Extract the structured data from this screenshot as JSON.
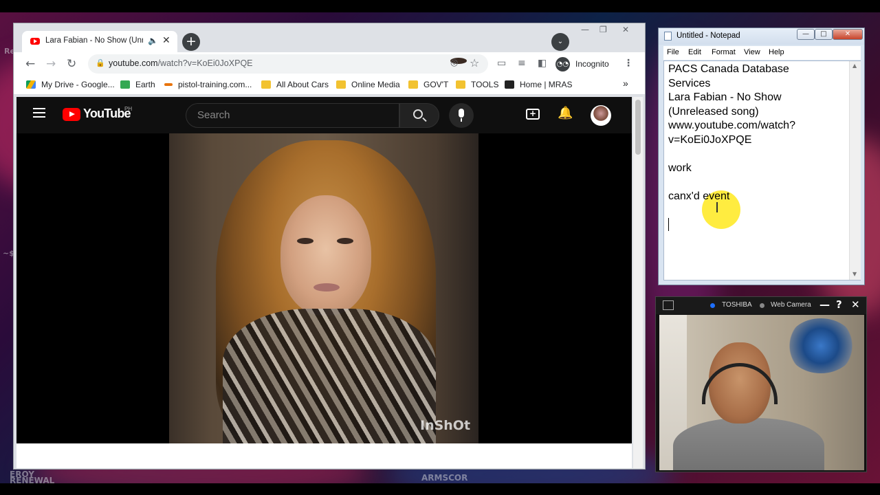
{
  "desktop": {
    "left_edge_text_1": "Re",
    "left_edge_text_2": "~$",
    "bottom_text_1": "EROY",
    "bottom_text_2": "RENEWAL",
    "bottom_text_3": "ARMSCOR"
  },
  "chrome": {
    "tab": {
      "title": "Lara Fabian - No Show (Unre",
      "close": "✕",
      "speaker": "🔈"
    },
    "new_tab": "+",
    "tab_search": "⌄",
    "window_controls": {
      "minimize": "—",
      "maximize": "❐",
      "close": "✕"
    },
    "nav": {
      "back": "←",
      "forward": "→",
      "reload": "↻"
    },
    "address": {
      "host": "youtube.com",
      "path": "/watch?v=KoEi0JoXPQE"
    },
    "incognito_label": "Incognito",
    "bookmarks": [
      {
        "label": "My Drive - Google...",
        "icon": "google-drive-icon"
      },
      {
        "label": "Earth",
        "icon": "google-earth-icon"
      },
      {
        "label": "pistol-training.com...",
        "icon": "pistol-training-icon"
      },
      {
        "label": "All About Cars",
        "icon": "folder-icon"
      },
      {
        "label": "Online Media",
        "icon": "folder-icon"
      },
      {
        "label": "GOV'T",
        "icon": "folder-icon"
      },
      {
        "label": "TOOLS",
        "icon": "folder-icon"
      },
      {
        "label": "Home | MRAS",
        "icon": "wix-icon"
      }
    ],
    "bookmarks_more": "»"
  },
  "youtube": {
    "logo_text": "YouTube",
    "country_code": "PH",
    "search_placeholder": "Search",
    "video_watermark": "InShOt"
  },
  "notepad": {
    "title": "Untitled - Notepad",
    "menu": [
      "File",
      "Edit",
      "Format",
      "View",
      "Help"
    ],
    "lines": [
      "PACS Canada Database",
      "Services",
      "Lara Fabian - No Show",
      "(Unreleased song)",
      "www.youtube.com/watch?",
      "v=KoEi0JoXPQE",
      "",
      "work",
      "",
      "canx'd event"
    ],
    "buttons": {
      "minimize": "—",
      "maximize": "□",
      "close": "✕"
    }
  },
  "webcam": {
    "brand": "TOSHIBA",
    "label": "Web Camera",
    "controls": {
      "minimize": "—",
      "help": "?",
      "close": "✕"
    }
  },
  "colors": {
    "youtube_red": "#ff0000",
    "youtube_dark": "#0f0f0f",
    "cursor_highlight": "#ffe600",
    "webcam_dot_blue": "#1e6fff"
  }
}
